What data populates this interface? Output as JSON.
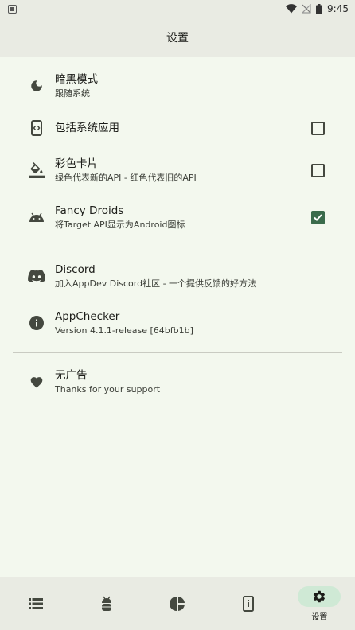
{
  "status_bar": {
    "time": "9:45"
  },
  "app_bar": {
    "title": "设置"
  },
  "settings": {
    "dark_mode": {
      "label": "暗黑模式",
      "sub": "跟随系统",
      "icon": "moon-icon"
    },
    "include_system": {
      "label": "包括系统应用",
      "icon": "system-app-icon",
      "checked": false
    },
    "color_cards": {
      "label": "彩色卡片",
      "sub": "绿色代表新的API - 红色代表旧的API",
      "icon": "paint-bucket-icon",
      "checked": false
    },
    "fancy_droids": {
      "label": "Fancy Droids",
      "sub": "将Target API显示为Android图标",
      "icon": "android-icon",
      "checked": true
    },
    "discord": {
      "label": "Discord",
      "sub": "加入AppDev Discord社区 - 一个提供反馈的好方法",
      "icon": "discord-icon"
    },
    "appchecker": {
      "label": "AppChecker",
      "sub": "Version 4.1.1-release [64bfb1b]",
      "icon": "info-icon"
    },
    "no_ads": {
      "label": "无广告",
      "sub": "Thanks for your support",
      "icon": "heart-icon"
    }
  },
  "bottom_nav": {
    "items": [
      {
        "id": "list",
        "icon": "list-icon"
      },
      {
        "id": "android",
        "icon": "android-bug-icon"
      },
      {
        "id": "chart",
        "icon": "pie-chart-icon"
      },
      {
        "id": "device",
        "icon": "phone-info-icon"
      },
      {
        "id": "settings",
        "icon": "gear-icon",
        "label": "设置",
        "active": true
      }
    ]
  },
  "colors": {
    "accent": "#3a6b4b",
    "background": "#f3f8ee",
    "bar": "#e9ebe3",
    "active_pill": "#cfe9d5"
  }
}
